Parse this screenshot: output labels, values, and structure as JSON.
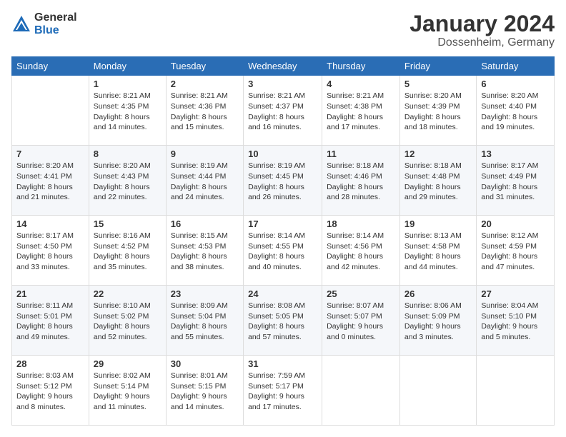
{
  "logo": {
    "general": "General",
    "blue": "Blue"
  },
  "title": "January 2024",
  "location": "Dossenheim, Germany",
  "days_header": [
    "Sunday",
    "Monday",
    "Tuesday",
    "Wednesday",
    "Thursday",
    "Friday",
    "Saturday"
  ],
  "weeks": [
    [
      {
        "day": "",
        "info": ""
      },
      {
        "day": "1",
        "info": "Sunrise: 8:21 AM\nSunset: 4:35 PM\nDaylight: 8 hours\nand 14 minutes."
      },
      {
        "day": "2",
        "info": "Sunrise: 8:21 AM\nSunset: 4:36 PM\nDaylight: 8 hours\nand 15 minutes."
      },
      {
        "day": "3",
        "info": "Sunrise: 8:21 AM\nSunset: 4:37 PM\nDaylight: 8 hours\nand 16 minutes."
      },
      {
        "day": "4",
        "info": "Sunrise: 8:21 AM\nSunset: 4:38 PM\nDaylight: 8 hours\nand 17 minutes."
      },
      {
        "day": "5",
        "info": "Sunrise: 8:20 AM\nSunset: 4:39 PM\nDaylight: 8 hours\nand 18 minutes."
      },
      {
        "day": "6",
        "info": "Sunrise: 8:20 AM\nSunset: 4:40 PM\nDaylight: 8 hours\nand 19 minutes."
      }
    ],
    [
      {
        "day": "7",
        "info": "Sunrise: 8:20 AM\nSunset: 4:41 PM\nDaylight: 8 hours\nand 21 minutes."
      },
      {
        "day": "8",
        "info": "Sunrise: 8:20 AM\nSunset: 4:43 PM\nDaylight: 8 hours\nand 22 minutes."
      },
      {
        "day": "9",
        "info": "Sunrise: 8:19 AM\nSunset: 4:44 PM\nDaylight: 8 hours\nand 24 minutes."
      },
      {
        "day": "10",
        "info": "Sunrise: 8:19 AM\nSunset: 4:45 PM\nDaylight: 8 hours\nand 26 minutes."
      },
      {
        "day": "11",
        "info": "Sunrise: 8:18 AM\nSunset: 4:46 PM\nDaylight: 8 hours\nand 28 minutes."
      },
      {
        "day": "12",
        "info": "Sunrise: 8:18 AM\nSunset: 4:48 PM\nDaylight: 8 hours\nand 29 minutes."
      },
      {
        "day": "13",
        "info": "Sunrise: 8:17 AM\nSunset: 4:49 PM\nDaylight: 8 hours\nand 31 minutes."
      }
    ],
    [
      {
        "day": "14",
        "info": "Sunrise: 8:17 AM\nSunset: 4:50 PM\nDaylight: 8 hours\nand 33 minutes."
      },
      {
        "day": "15",
        "info": "Sunrise: 8:16 AM\nSunset: 4:52 PM\nDaylight: 8 hours\nand 35 minutes."
      },
      {
        "day": "16",
        "info": "Sunrise: 8:15 AM\nSunset: 4:53 PM\nDaylight: 8 hours\nand 38 minutes."
      },
      {
        "day": "17",
        "info": "Sunrise: 8:14 AM\nSunset: 4:55 PM\nDaylight: 8 hours\nand 40 minutes."
      },
      {
        "day": "18",
        "info": "Sunrise: 8:14 AM\nSunset: 4:56 PM\nDaylight: 8 hours\nand 42 minutes."
      },
      {
        "day": "19",
        "info": "Sunrise: 8:13 AM\nSunset: 4:58 PM\nDaylight: 8 hours\nand 44 minutes."
      },
      {
        "day": "20",
        "info": "Sunrise: 8:12 AM\nSunset: 4:59 PM\nDaylight: 8 hours\nand 47 minutes."
      }
    ],
    [
      {
        "day": "21",
        "info": "Sunrise: 8:11 AM\nSunset: 5:01 PM\nDaylight: 8 hours\nand 49 minutes."
      },
      {
        "day": "22",
        "info": "Sunrise: 8:10 AM\nSunset: 5:02 PM\nDaylight: 8 hours\nand 52 minutes."
      },
      {
        "day": "23",
        "info": "Sunrise: 8:09 AM\nSunset: 5:04 PM\nDaylight: 8 hours\nand 55 minutes."
      },
      {
        "day": "24",
        "info": "Sunrise: 8:08 AM\nSunset: 5:05 PM\nDaylight: 8 hours\nand 57 minutes."
      },
      {
        "day": "25",
        "info": "Sunrise: 8:07 AM\nSunset: 5:07 PM\nDaylight: 9 hours\nand 0 minutes."
      },
      {
        "day": "26",
        "info": "Sunrise: 8:06 AM\nSunset: 5:09 PM\nDaylight: 9 hours\nand 3 minutes."
      },
      {
        "day": "27",
        "info": "Sunrise: 8:04 AM\nSunset: 5:10 PM\nDaylight: 9 hours\nand 5 minutes."
      }
    ],
    [
      {
        "day": "28",
        "info": "Sunrise: 8:03 AM\nSunset: 5:12 PM\nDaylight: 9 hours\nand 8 minutes."
      },
      {
        "day": "29",
        "info": "Sunrise: 8:02 AM\nSunset: 5:14 PM\nDaylight: 9 hours\nand 11 minutes."
      },
      {
        "day": "30",
        "info": "Sunrise: 8:01 AM\nSunset: 5:15 PM\nDaylight: 9 hours\nand 14 minutes."
      },
      {
        "day": "31",
        "info": "Sunrise: 7:59 AM\nSunset: 5:17 PM\nDaylight: 9 hours\nand 17 minutes."
      },
      {
        "day": "",
        "info": ""
      },
      {
        "day": "",
        "info": ""
      },
      {
        "day": "",
        "info": ""
      }
    ]
  ]
}
